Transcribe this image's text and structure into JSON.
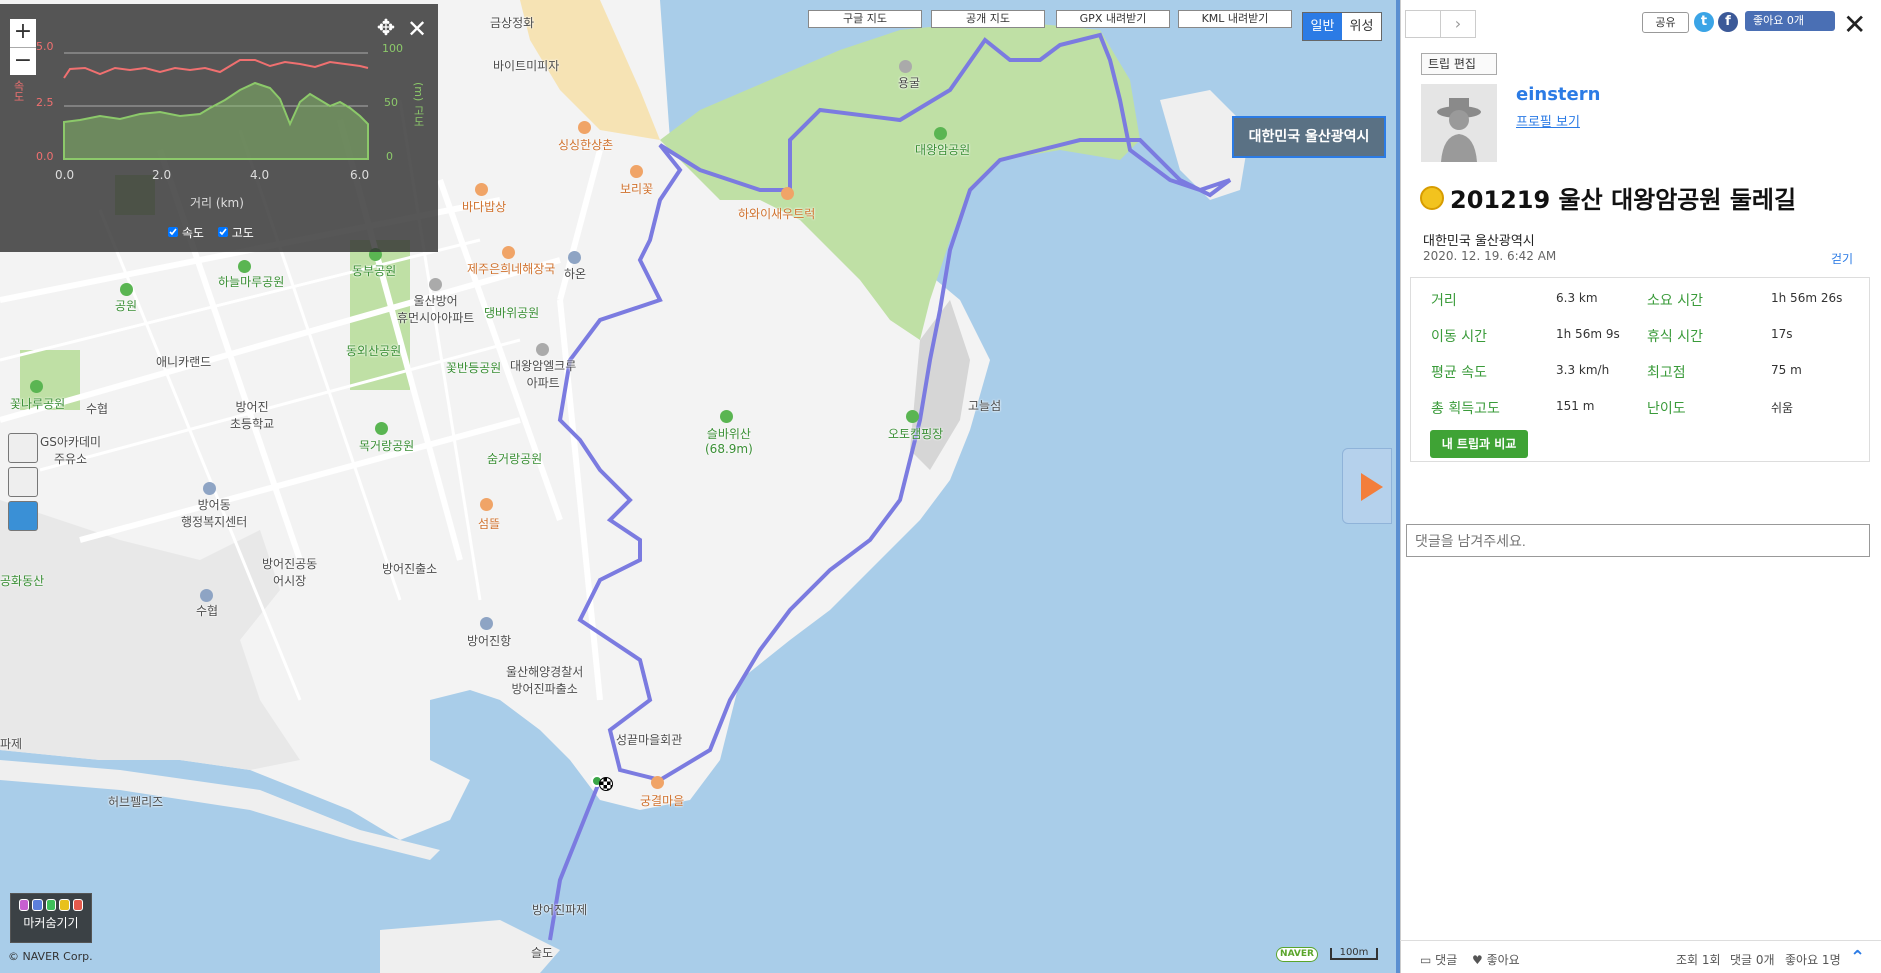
{
  "map": {
    "top_buttons": [
      "구글 지도",
      "공개 지도",
      "GPX 내려받기",
      "KML 내려받기"
    ],
    "map_type": {
      "normal": "일반",
      "satellite": "위성"
    },
    "region_tag": "대한민국 울산광역시",
    "zoom": {
      "in": "+",
      "out": "−"
    },
    "marker_toggle_label": "마커숨기기",
    "copyright": "© NAVER Corp.",
    "naver_logo": "NAVER",
    "scale_label": "100m",
    "labels": {
      "geumsang": "금상정화",
      "bayt": "바이트미피자",
      "singsing": "싱싱한상촌",
      "borikkot": "보리꽃",
      "hawaii": "하와이새우트럭",
      "badabapsang": "바다밥상",
      "yonggul": "용굴",
      "daewangam_park": "대왕암공원",
      "jeju": "제주은희네해장국",
      "haon": "하온",
      "dongbu_park": "동부공원",
      "hyundai_apt": "울산방어\n휴먼시아아파트",
      "daebawi": "댕바위공원",
      "haneulmaru": "하늘마루공원",
      "park": "공원",
      "dongoesan": "동외산공원",
      "kkotbandeung": "꽃반등공원",
      "daewangam_apt": "대왕암엘크루\n아파트",
      "annie": "애니카랜드",
      "kkotnaru": "꽃나루공원",
      "suhyeop": "수협",
      "bangeojin_school": "방어진\n초등학교",
      "gs": "GS아카데미\n주유소",
      "mokgeorang": "목거랑공원",
      "sumgeorang": "숨거랑공원",
      "seulbawisan": "슬바위산\n(68.9m)",
      "autocamp": "오토캠핑장",
      "bangeodong_center": "방어동\n행정복지센터",
      "seomkkeut": "섬뜰",
      "market": "방어진공동\n어시장",
      "bangeojin_office": "방어진출소",
      "gonghwadong": "공화동산",
      "suhyeop2": "수협",
      "bangeojinhang": "방어진항",
      "coastguard": "울산해양경찰서\n방어진파출소",
      "seongkkeut": "성끝마을회관",
      "herb": "허브펠리즈",
      "pier": "방어진파제",
      "gungyeol": "궁결마을",
      "sulgo": "슬도",
      "pajet": "파제",
      "island": "고늘섬"
    }
  },
  "chart": {
    "left_axis_ticks": [
      "5.0",
      "2.5",
      "0.0"
    ],
    "right_axis_ticks": [
      "100",
      "50",
      "0"
    ],
    "x_ticks": [
      "0.0",
      "2.0",
      "4.0",
      "6.0"
    ],
    "x_label": "거리 (km)",
    "left_label": "속도",
    "right_label": "(m) 고도",
    "legend_speed": "속도",
    "legend_alt": "고도",
    "speed_color": "#f07070",
    "alt_color": "#8cc96a"
  },
  "panel": {
    "share": "공유",
    "fb_like": "좋아요 0개",
    "trip_edit": "트립 편집",
    "username": "einstern",
    "profile_link": "프로필 보기",
    "title": "201219 울산 대왕암공원 둘레길",
    "region": "대한민국 울산광역시",
    "date": "2020. 12. 19. 6:42 AM",
    "activity": "걷기",
    "stats": {
      "distance_label": "거리",
      "distance": "6.3 km",
      "duration_label": "소요 시간",
      "duration": "1h 56m 26s",
      "moving_label": "이동 시간",
      "moving": "1h 56m 9s",
      "rest_label": "휴식 시간",
      "rest": "17s",
      "avgspeed_label": "평균 속도",
      "avgspeed": "3.3 km/h",
      "maxalt_label": "최고점",
      "maxalt": "75 m",
      "gain_label": "총 획득고도",
      "gain": "151 m",
      "difficulty_label": "난이도",
      "difficulty": "쉬움"
    },
    "compare_btn": "내 트립과 비교",
    "comment_placeholder": "댓글을 남겨주세요.",
    "bottom": {
      "comment": "댓글",
      "like": "좋아요",
      "views": "조회 1회",
      "comments_count": "댓글 0개",
      "likes_count": "좋아요 1명"
    }
  },
  "colors": {
    "route": "#7b7be0",
    "accent": "#2b7be5",
    "park": "#bfe0a5",
    "water": "#a9cde9",
    "land": "#f3f3f3"
  }
}
